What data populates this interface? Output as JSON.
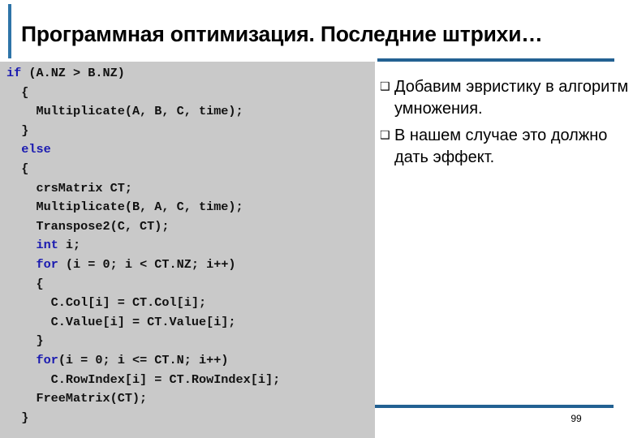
{
  "slide": {
    "title": "Программная оптимизация. Последние штрихи…",
    "page_number": "99",
    "accent_color": "#236192",
    "code_panel_bg": "#C9C9C9",
    "keyword_color": "#1A1AB0"
  },
  "code": {
    "language": "cpp",
    "lines": [
      [
        {
          "t": "if",
          "k": true
        },
        {
          "t": " (A.NZ > B.NZ)",
          "k": false
        }
      ],
      [
        {
          "t": "  {",
          "k": false
        }
      ],
      [
        {
          "t": "    Multiplicate(A, B, C, time);",
          "k": false
        }
      ],
      [
        {
          "t": "  }",
          "k": false
        }
      ],
      [
        {
          "t": "  ",
          "k": false
        },
        {
          "t": "else",
          "k": true
        }
      ],
      [
        {
          "t": "  {",
          "k": false
        }
      ],
      [
        {
          "t": "    crsMatrix CT;",
          "k": false
        }
      ],
      [
        {
          "t": "    Multiplicate(B, A, C, time);",
          "k": false
        }
      ],
      [
        {
          "t": "    Transpose2(C, CT);",
          "k": false
        }
      ],
      [
        {
          "t": "    ",
          "k": false
        },
        {
          "t": "int",
          "k": true
        },
        {
          "t": " i;",
          "k": false
        }
      ],
      [
        {
          "t": "    ",
          "k": false
        },
        {
          "t": "for",
          "k": true
        },
        {
          "t": " (i = 0; i < CT.NZ; i++)",
          "k": false
        }
      ],
      [
        {
          "t": "    {",
          "k": false
        }
      ],
      [
        {
          "t": "      C.Col[i] = CT.Col[i];",
          "k": false
        }
      ],
      [
        {
          "t": "      C.Value[i] = CT.Value[i];",
          "k": false
        }
      ],
      [
        {
          "t": "    }",
          "k": false
        }
      ],
      [
        {
          "t": "    ",
          "k": false
        },
        {
          "t": "for",
          "k": true
        },
        {
          "t": "(i = 0; i <= CT.N; i++)",
          "k": false
        }
      ],
      [
        {
          "t": "      C.RowIndex[i] = CT.RowIndex[i];",
          "k": false
        }
      ],
      [
        {
          "t": "    FreeMatrix(CT);",
          "k": false
        }
      ],
      [
        {
          "t": "  }",
          "k": false
        }
      ]
    ]
  },
  "bullets": {
    "marker": "❑",
    "items": [
      "Добавим эвристику в алгоритм умножения.",
      "В нашем случае это должно дать эффект."
    ]
  }
}
